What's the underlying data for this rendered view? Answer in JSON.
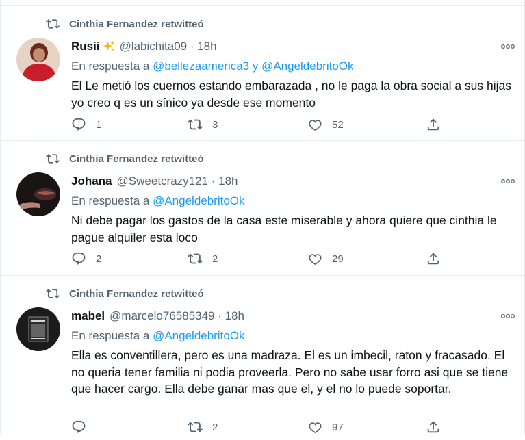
{
  "tweets": [
    {
      "retweeter": "Cinthia Fernandez retwitteó",
      "name": "Rusii",
      "has_sparkle": true,
      "handle": "@labichita09 · 18h",
      "reply_prefix": "En respuesta a ",
      "reply_mentions": "@bellezaamerica3 y @AngeldebritoOk",
      "text": "El Le metió los cuernos estando embarazada , no le paga la obra social a sus hijas  yo creo q es un sínico ya desde ese momento",
      "replies": "1",
      "retweets": "3",
      "likes": "52",
      "avatar_colors": [
        "#c81e2a",
        "#6b2a1c",
        "#e7d3c5"
      ]
    },
    {
      "retweeter": "Cinthia Fernandez retwitteó",
      "name": "Johana",
      "has_sparkle": false,
      "handle": "@Sweetcrazy121 · 18h",
      "reply_prefix": "En respuesta a ",
      "reply_mentions": "@AngeldebritoOk",
      "text": "Ni debe pagar los gastos de la casa este miserable y ahora quiere que cinthia le pague alquiler esta loco",
      "replies": "2",
      "retweets": "2",
      "likes": "29",
      "avatar_colors": [
        "#1a1414",
        "#9c5b4e",
        "#4a2a28"
      ]
    },
    {
      "retweeter": "Cinthia Fernandez retwitteó",
      "name": "mabel",
      "has_sparkle": false,
      "handle": "@marcelo76585349 · 18h",
      "reply_prefix": "En respuesta a ",
      "reply_mentions": "@AngeldebritoOk",
      "text": "Ella es conventillera, pero es una madraza. El es un imbecil, raton y fracasado. El no queria tener familia ni podia proveerla. Pero no sabe usar forro asi que se tiene que hacer cargo. Ella debe ganar mas que el, y el no lo puede soportar.",
      "replies": "",
      "retweets": "2",
      "likes": "97",
      "avatar_colors": [
        "#1b1b1b",
        "#d8d8d8",
        "#8a8a8a"
      ]
    }
  ]
}
